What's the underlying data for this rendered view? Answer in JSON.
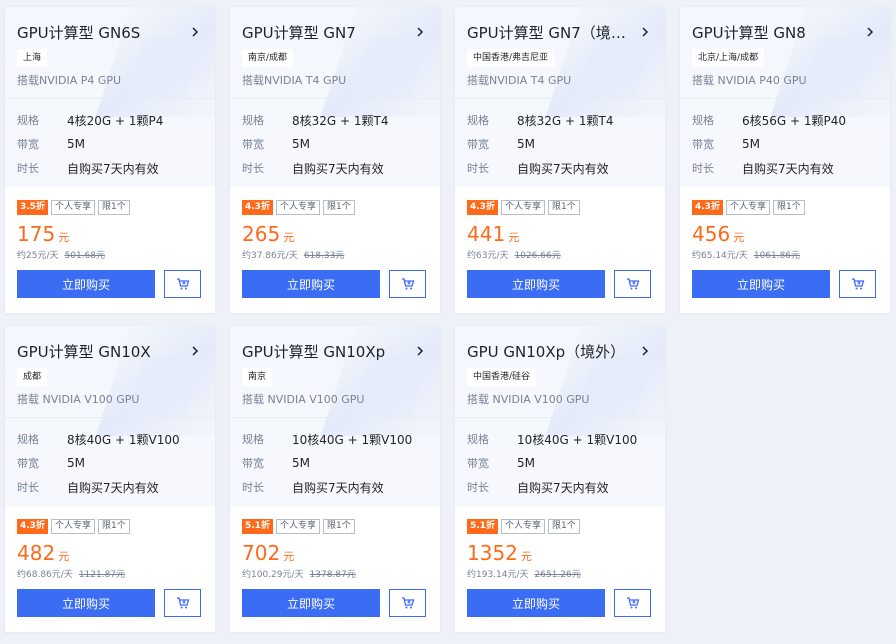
{
  "theme": {
    "accent": "#3b6cf4",
    "discount": "#ff6a1a",
    "background": "#eef1f8"
  },
  "cards": [
    {
      "title": "GPU计算型 GN6S",
      "region": "上海",
      "gpu": "搭载NVIDIA P4 GPU",
      "spec_label": "规格",
      "spec": "4核20G + 1颗P4",
      "bw_label": "带宽",
      "bw": "5M",
      "dur_label": "时长",
      "dur": "自购买7天内有效",
      "discount": "3.5折",
      "tag1": "个人专享",
      "tag2": "限1个",
      "price": "175",
      "unit": "元",
      "daily": "约25元/天",
      "original": "501.68元",
      "buy_label": "立即购买",
      "chevron_icon": "chevron-right-icon",
      "cart_icon": "cart-icon"
    },
    {
      "title": "GPU计算型 GN7",
      "region": "南京/成都",
      "gpu": "搭载NVIDIA T4 GPU",
      "spec_label": "规格",
      "spec": "8核32G + 1颗T4",
      "bw_label": "带宽",
      "bw": "5M",
      "dur_label": "时长",
      "dur": "自购买7天内有效",
      "discount": "4.3折",
      "tag1": "个人专享",
      "tag2": "限1个",
      "price": "265",
      "unit": "元",
      "daily": "约37.86元/天",
      "original": "618.33元",
      "buy_label": "立即购买",
      "chevron_icon": "chevron-right-icon",
      "cart_icon": "cart-icon"
    },
    {
      "title": "GPU计算型 GN7（境外）",
      "region": "中国香港/弗吉尼亚",
      "gpu": "搭载NVIDIA T4 GPU",
      "spec_label": "规格",
      "spec": "8核32G + 1颗T4",
      "bw_label": "带宽",
      "bw": "5M",
      "dur_label": "时长",
      "dur": "自购买7天内有效",
      "discount": "4.3折",
      "tag1": "个人专享",
      "tag2": "限1个",
      "price": "441",
      "unit": "元",
      "daily": "约63元/天",
      "original": "1026.66元",
      "buy_label": "立即购买",
      "chevron_icon": "chevron-right-icon",
      "cart_icon": "cart-icon"
    },
    {
      "title": "GPU计算型 GN8",
      "region": "北京/上海/成都",
      "gpu": "搭载 NVIDIA P40 GPU",
      "spec_label": "规格",
      "spec": "6核56G + 1颗P40",
      "bw_label": "带宽",
      "bw": "5M",
      "dur_label": "时长",
      "dur": "自购买7天内有效",
      "discount": "4.3折",
      "tag1": "个人专享",
      "tag2": "限1个",
      "price": "456",
      "unit": "元",
      "daily": "约65.14元/天",
      "original": "1061.86元",
      "buy_label": "立即购买",
      "chevron_icon": "chevron-right-icon",
      "cart_icon": "cart-icon"
    },
    {
      "title": "GPU计算型 GN10X",
      "region": "成都",
      "gpu": "搭载 NVIDIA V100 GPU",
      "spec_label": "规格",
      "spec": "8核40G + 1颗V100",
      "bw_label": "带宽",
      "bw": "5M",
      "dur_label": "时长",
      "dur": "自购买7天内有效",
      "discount": "4.3折",
      "tag1": "个人专享",
      "tag2": "限1个",
      "price": "482",
      "unit": "元",
      "daily": "约68.86元/天",
      "original": "1121.87元",
      "buy_label": "立即购买",
      "chevron_icon": "chevron-right-icon",
      "cart_icon": "cart-icon"
    },
    {
      "title": "GPU计算型 GN10Xp",
      "region": "南京",
      "gpu": "搭载 NVIDIA V100 GPU",
      "spec_label": "规格",
      "spec": "10核40G + 1颗V100",
      "bw_label": "带宽",
      "bw": "5M",
      "dur_label": "时长",
      "dur": "自购买7天内有效",
      "discount": "5.1折",
      "tag1": "个人专享",
      "tag2": "限1个",
      "price": "702",
      "unit": "元",
      "daily": "约100.29元/天",
      "original": "1378.87元",
      "buy_label": "立即购买",
      "chevron_icon": "chevron-right-icon",
      "cart_icon": "cart-icon"
    },
    {
      "title": "GPU GN10Xp（境外）",
      "region": "中国香港/硅谷",
      "gpu": "搭载 NVIDIA V100 GPU",
      "spec_label": "规格",
      "spec": "10核40G + 1颗V100",
      "bw_label": "带宽",
      "bw": "5M",
      "dur_label": "时长",
      "dur": "自购买7天内有效",
      "discount": "5.1折",
      "tag1": "个人专享",
      "tag2": "限1个",
      "price": "1352",
      "unit": "元",
      "daily": "约193.14元/天",
      "original": "2651.26元",
      "buy_label": "立即购买",
      "chevron_icon": "chevron-right-icon",
      "cart_icon": "cart-icon"
    }
  ]
}
